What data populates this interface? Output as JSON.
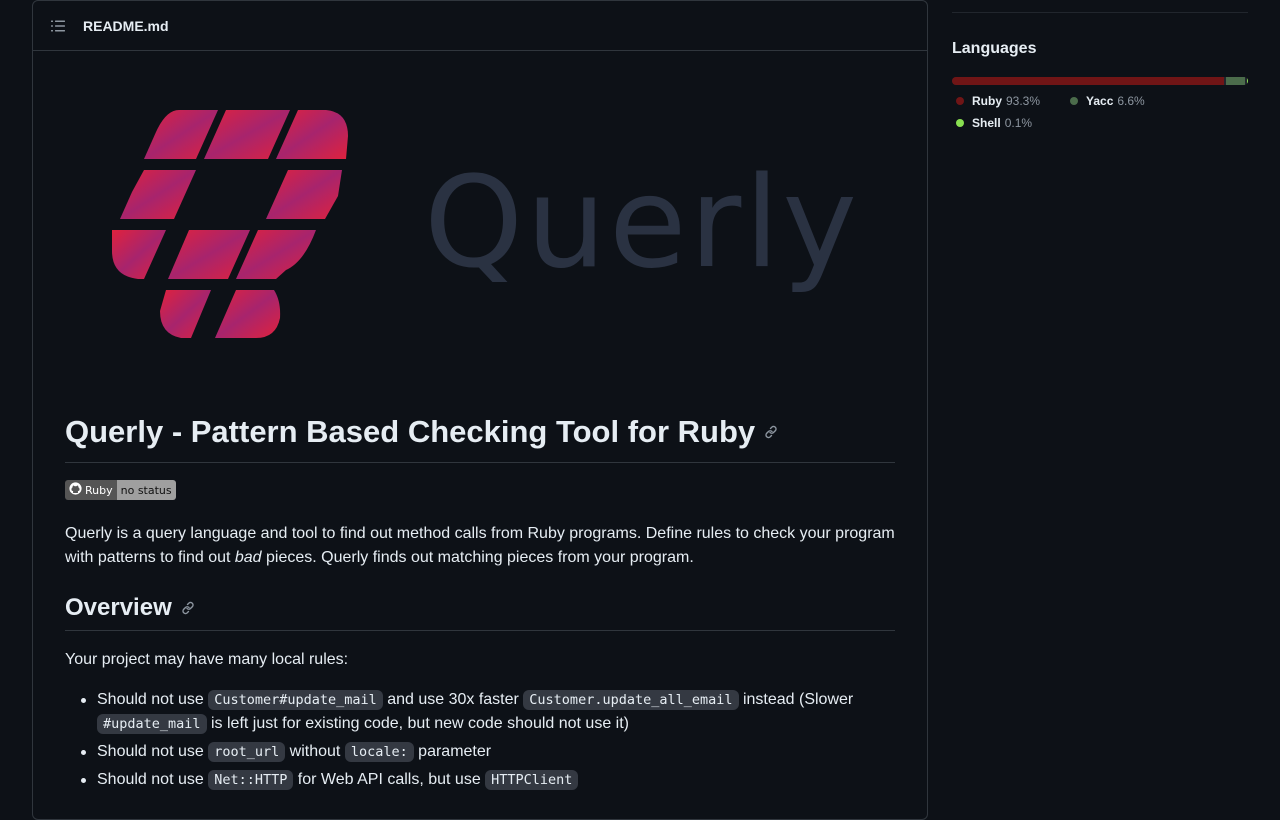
{
  "readme": {
    "filename": "README.md",
    "hero_word": "Querly",
    "title": "Querly - Pattern Based Checking Tool for Ruby",
    "badge": {
      "label": "Ruby",
      "status": "no status"
    },
    "intro": {
      "part1": "Querly is a query language and tool to find out method calls from Ruby programs. Define rules to check your program with patterns to find out ",
      "emphasis": "bad",
      "part2": " pieces. Querly finds out matching pieces from your program."
    },
    "overview_heading": "Overview",
    "overview_para": "Your project may have many local rules:",
    "rules": [
      {
        "t1": "Should not use ",
        "c1": "Customer#update_mail",
        "t2": " and use 30x faster ",
        "c2": "Customer.update_all_email",
        "t3": " instead (Slower ",
        "c3": "#update_mail",
        "t4": " is left just for existing code, but new code should not use it)"
      },
      {
        "t1": "Should not use ",
        "c1": "root_url",
        "t2": " without ",
        "c2": "locale:",
        "t3": " parameter"
      },
      {
        "t1": "Should not use ",
        "c1": "Net::HTTP",
        "t2": " for Web API calls, but use ",
        "c2": "HTTPClient"
      }
    ]
  },
  "sidebar": {
    "languages_title": "Languages",
    "languages": [
      {
        "name": "Ruby",
        "percent": "93.3%",
        "value": 93.3,
        "color": "#701516"
      },
      {
        "name": "Yacc",
        "percent": "6.6%",
        "value": 6.6,
        "color": "#4b6c4b"
      },
      {
        "name": "Shell",
        "percent": "0.1%",
        "value": 0.1,
        "color": "#89e051"
      }
    ]
  },
  "colors": {
    "background": "#0d1117",
    "border": "#30363d",
    "text": "#e6edf3",
    "muted": "#8d96a0",
    "logo_red": "#e0223d",
    "logo_magenta": "#a7246d"
  },
  "icons": {
    "toc": "list-unordered-icon",
    "anchor": "link-icon",
    "badge": "github-icon"
  }
}
